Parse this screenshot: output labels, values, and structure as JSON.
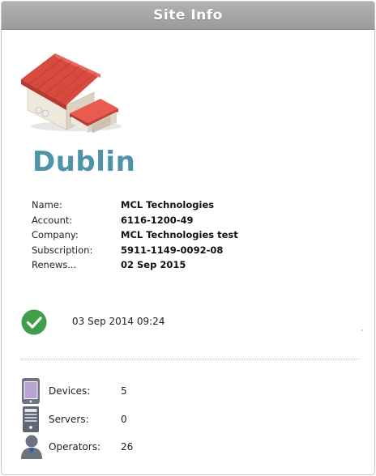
{
  "header": {
    "title": "Site Info"
  },
  "site": {
    "name": "Dublin"
  },
  "details": {
    "rows": [
      {
        "label": "Name:",
        "value": "MCL Technologies"
      },
      {
        "label": "Account:",
        "value": "6116-1200-49"
      },
      {
        "label": "Company:",
        "value": "MCL Technologies test"
      },
      {
        "label": "Subscription:",
        "value": "5911-1149-0092-08"
      },
      {
        "label": "Renews...",
        "value": "02 Sep 2015"
      }
    ]
  },
  "status": {
    "icon": "check-circle-icon",
    "timestamp": "03 Sep 2014 09:24",
    "color": "#3f9e4a"
  },
  "stats": {
    "devices": {
      "label": "Devices:",
      "value": "5",
      "icon": "device-icon"
    },
    "servers": {
      "label": "Servers:",
      "value": "0",
      "icon": "server-icon"
    },
    "operators": {
      "label": "Operators:",
      "value": "26",
      "icon": "operator-icon"
    }
  },
  "colors": {
    "site_name": "#4e93a8",
    "header_bg": "#a6a6a6"
  }
}
